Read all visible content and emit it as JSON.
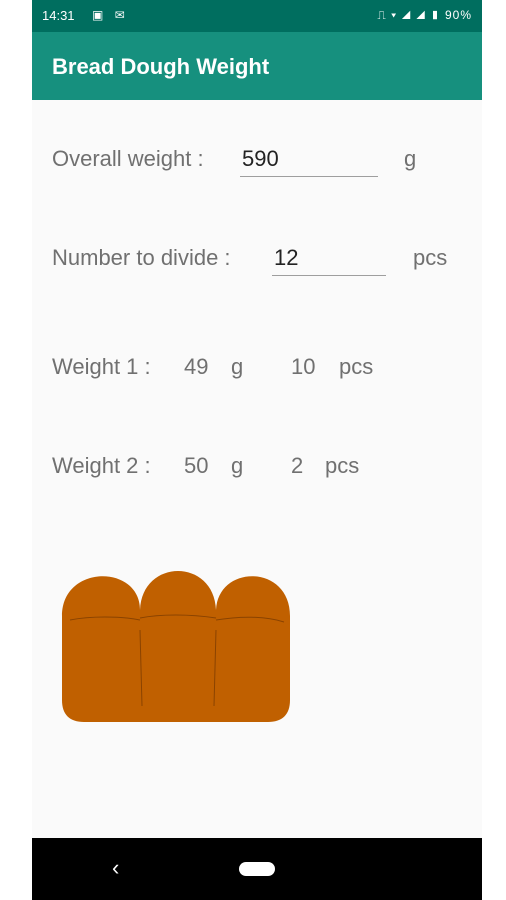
{
  "status_bar": {
    "time": "14:31",
    "left_icons": [
      "image-icon",
      "gmail-icon"
    ],
    "right_icons": [
      "vibrate-icon",
      "wifi-icon",
      "signal-icon",
      "signal-icon",
      "battery-icon"
    ],
    "battery": "90%"
  },
  "app_bar": {
    "title": "Bread Dough Weight"
  },
  "form": {
    "overall_weight": {
      "label": "Overall weight :",
      "value": "590",
      "unit": "g"
    },
    "number_to_divide": {
      "label": "Number to divide :",
      "value": "12",
      "unit": "pcs"
    }
  },
  "results": {
    "weight1": {
      "label": "Weight 1 :",
      "weight": "49",
      "weight_unit": "g",
      "count": "10",
      "count_unit": "pcs"
    },
    "weight2": {
      "label": "Weight 2 :",
      "weight": "50",
      "weight_unit": "g",
      "count": "2",
      "count_unit": "pcs"
    }
  },
  "nav_bar": {
    "back_glyph": "‹"
  },
  "colors": {
    "app_bar": "#16907e",
    "status_bar": "#006e5f",
    "bread": "#c06000"
  }
}
